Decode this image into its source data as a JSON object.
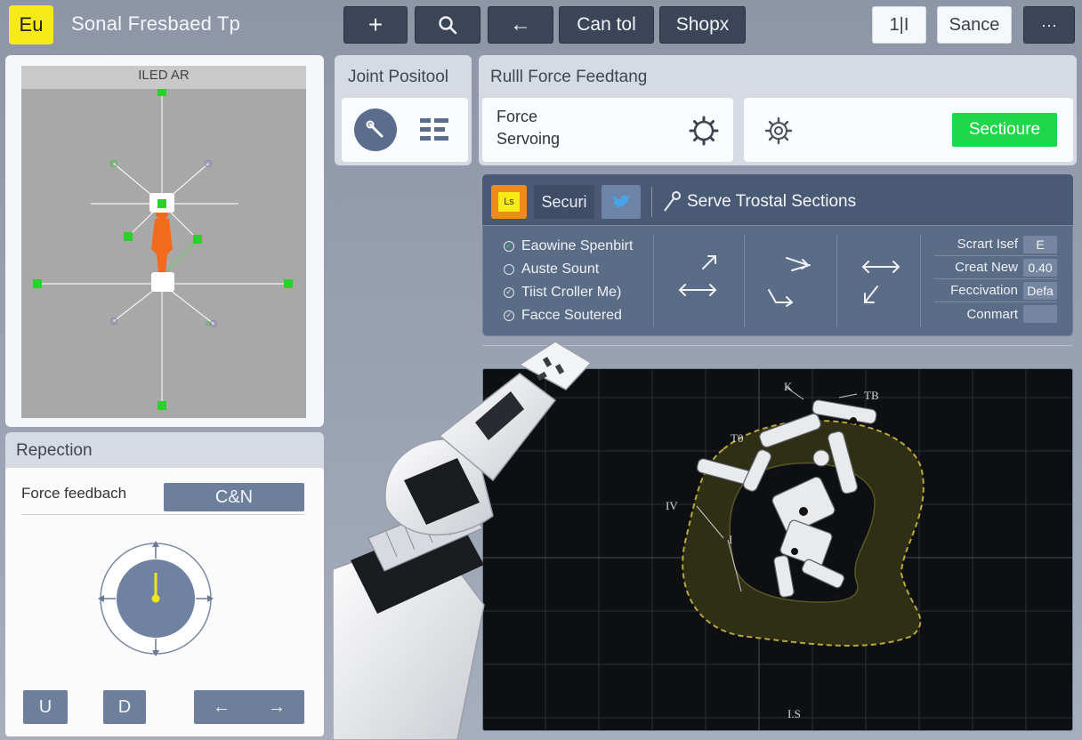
{
  "app": {
    "logo": "Eu",
    "title": "Sonal Fresbaed Tp"
  },
  "toolbar": {
    "add_label": "+",
    "search_icon": "search-icon",
    "back_label": "←",
    "control_label": "Can tol",
    "shopx_label": "Shopx",
    "split_label": "1|I",
    "sance_label": "Sance",
    "more_label": "···"
  },
  "viewport": {
    "label": "ILED AR"
  },
  "repection": {
    "title": "Repection",
    "force_label": "Force feedbach",
    "csn_label": "C&N",
    "u_label": "U",
    "d_label": "D",
    "left_arrow": "←",
    "right_arrow": "→"
  },
  "joint": {
    "title": "Joint Positool"
  },
  "force": {
    "title": "Rulll Force Feedtang",
    "servo_label_1": "Force",
    "servo_label_2": "Servoing",
    "sectioure_label": "Sectioure"
  },
  "serve": {
    "badge": "Ls",
    "securi_label": "Securi",
    "title": "Serve Trostal Sections",
    "checks": [
      {
        "label": "Eaowine Spenbirt",
        "checked": true
      },
      {
        "label": "Auste Sount",
        "checked": false
      },
      {
        "label": "Tiist Croller Me)",
        "checked": true
      },
      {
        "label": "Facce Soutered",
        "checked": true
      }
    ],
    "settings": [
      {
        "label": "Scrart Isef",
        "value": "E"
      },
      {
        "label": "Creat New",
        "value": "0.40"
      },
      {
        "label": "Feccivation",
        "value": "Defa"
      },
      {
        "label": "Conmart",
        "value": ""
      }
    ]
  },
  "scene": {
    "labels": {
      "k": "K",
      "tb": "TB",
      "t0": "T0",
      "iv": "IV",
      "i": "I",
      "bottom": "I.S"
    }
  },
  "colors": {
    "accent_green": "#1ed74a",
    "logo_yellow": "#f6ea19",
    "panel_slate": "#5b6c87",
    "handle_green": "#2bd12b",
    "figure_orange": "#f26b1d"
  }
}
